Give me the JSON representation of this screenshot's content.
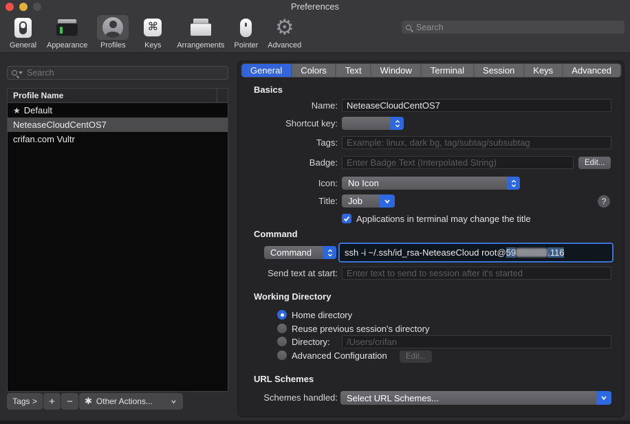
{
  "window": {
    "title": "Preferences"
  },
  "colors": {
    "accent_blue": "#2e68e0",
    "tab_selected_blue": "#3464d9",
    "text_selection_blue": "#3d5c84",
    "traffic_red": "#f0504a",
    "traffic_yellow": "#e3b23a",
    "traffic_gray": "#4e4e50",
    "panel_background": "#242426",
    "toolbar_background": "#39393b"
  },
  "icons": {
    "star": "★",
    "other_actions_gear": "✱",
    "keys_command": "⌘",
    "advanced_gear": "⚙"
  },
  "toolbar": {
    "search_placeholder": "Search",
    "items": [
      {
        "label": "General"
      },
      {
        "label": "Appearance"
      },
      {
        "label": "Profiles",
        "selected": true
      },
      {
        "label": "Keys"
      },
      {
        "label": "Arrangements"
      },
      {
        "label": "Pointer"
      },
      {
        "label": "Advanced"
      }
    ]
  },
  "sidebar": {
    "search_placeholder": "Search",
    "column_header": "Profile Name",
    "profiles": [
      {
        "name": "Default",
        "starred": true
      },
      {
        "name": "NeteaseCloudCentOS7",
        "selected": true
      },
      {
        "name": "crifan.com Vultr"
      }
    ],
    "footer": {
      "tags_label": "Tags >",
      "add_label": "+",
      "remove_label": "−",
      "other_actions_label": "Other Actions..."
    }
  },
  "panel": {
    "tabs": [
      "General",
      "Colors",
      "Text",
      "Window",
      "Terminal",
      "Session",
      "Keys",
      "Advanced"
    ],
    "selected_tab": "General",
    "basics": {
      "heading": "Basics",
      "name_label": "Name:",
      "name_value": "NeteaseCloudCentOS7",
      "shortcut_label": "Shortcut key:",
      "tags_label": "Tags:",
      "tags_placeholder": "Example: linux, dark bg, tag/subtag/subsubtag",
      "badge_label": "Badge:",
      "badge_placeholder": "Enter Badge Text (Interpolated String)",
      "badge_edit_label": "Edit...",
      "icon_label": "Icon:",
      "icon_value": "No Icon",
      "title_label": "Title:",
      "title_value": "Job",
      "help_label": "?",
      "checkbox_label": "Applications in terminal may change the title",
      "checkbox_checked": true
    },
    "command": {
      "heading": "Command",
      "type_value": "Command",
      "command_prefix": "ssh -i ~/.ssh/id_rsa-NeteaseCloud root@",
      "command_selected_start": "59",
      "command_selected_end": ".116",
      "send_text_label": "Send text at start:",
      "send_text_placeholder": "Enter text to send to session after it's started"
    },
    "working_directory": {
      "heading": "Working Directory",
      "options": [
        {
          "label": "Home directory",
          "selected": true
        },
        {
          "label": "Reuse previous session's directory",
          "selected": false
        },
        {
          "label": "Directory:",
          "selected": false,
          "placeholder": "/Users/crifan"
        },
        {
          "label": "Advanced Configuration",
          "selected": false,
          "edit_label": "Edit..."
        }
      ]
    },
    "url_schemes": {
      "heading": "URL Schemes",
      "label": "Schemes handled:",
      "value": "Select URL Schemes..."
    }
  }
}
